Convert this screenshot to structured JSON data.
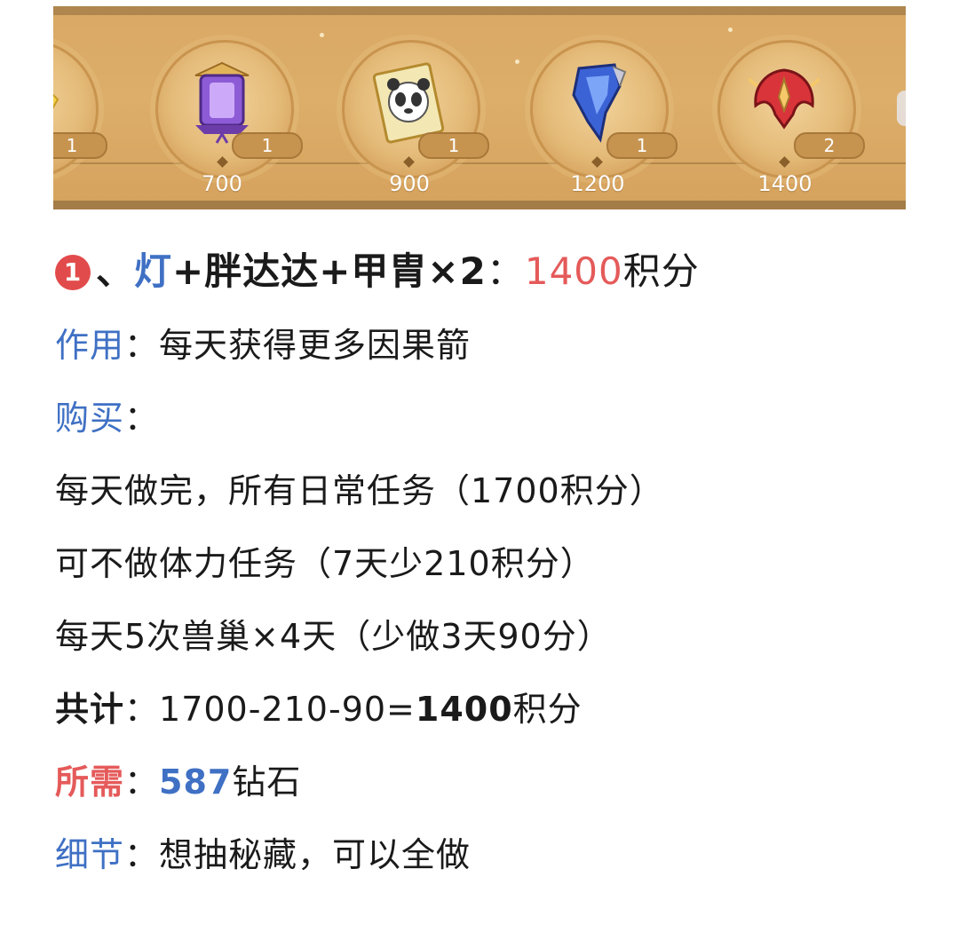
{
  "rewards": [
    {
      "count": "1",
      "score": "700",
      "item": "lantern-icon"
    },
    {
      "count": "1",
      "score": "900",
      "item": "panda-card-icon"
    },
    {
      "count": "1",
      "score": "1200",
      "item": "blue-armor-icon"
    },
    {
      "count": "2",
      "score": "1400",
      "item": "red-helmet-icon"
    }
  ],
  "partial_reward": {
    "count": "1"
  },
  "heading": {
    "number": "1",
    "sep": "、",
    "item1": "灯",
    "rest": "+胖达达+甲胄×2",
    "colon": "：",
    "points": "1400",
    "unit": "积分"
  },
  "lines": {
    "effect_label": "作用",
    "effect_value": "每天获得更多因果箭",
    "buy_label": "购买",
    "buy_line1": "每天做完，所有日常任务（1700积分）",
    "buy_line2": "可不做体力任务（7天少210积分）",
    "buy_line3": "每天5次兽巢×4天（少做3天90分）",
    "total_label": "共计",
    "total_expr": "1700-210-90=",
    "total_value": "1400",
    "total_unit": "积分",
    "need_label": "所需",
    "need_value": "587",
    "need_unit": "钻石",
    "detail_label": "细节",
    "detail_value": "想抽秘藏，可以全做",
    "colon": "："
  },
  "colors": {
    "blue": "#3f70c4",
    "red": "#e55a5a",
    "strip": "#d9a864"
  }
}
